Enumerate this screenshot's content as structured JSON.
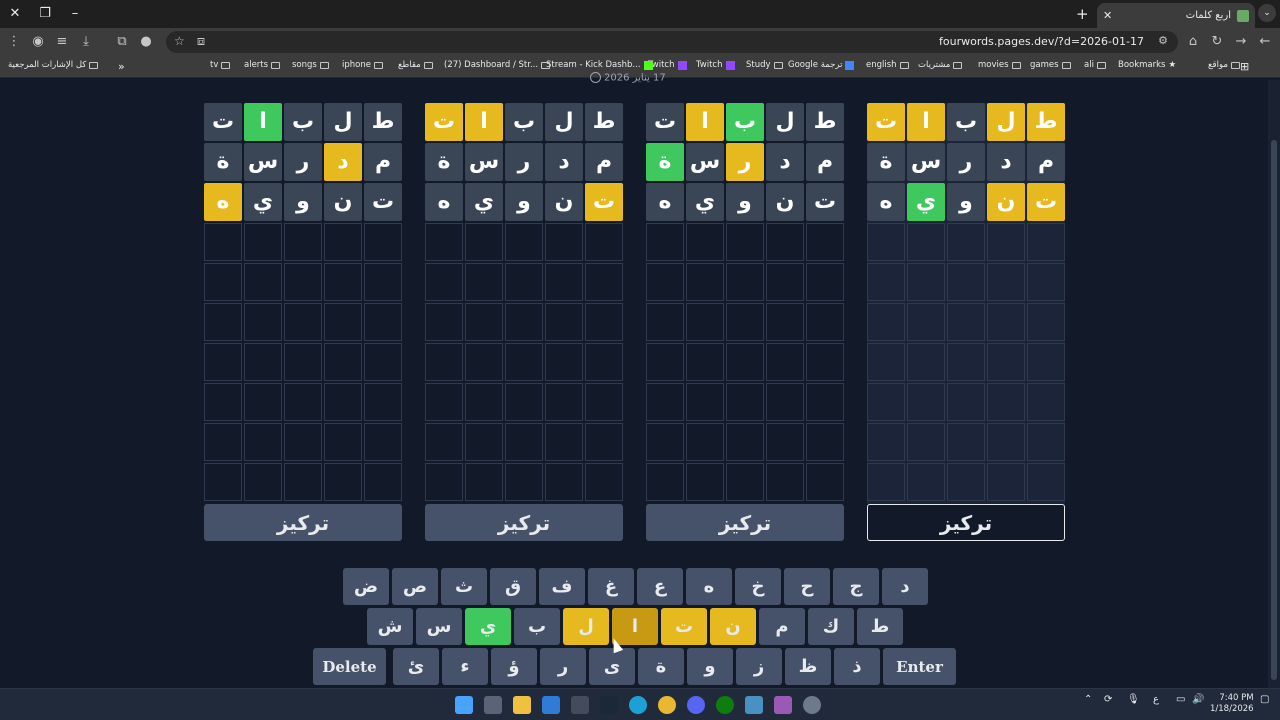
{
  "browser": {
    "tab_title": "أربع كلمات",
    "url": "fourwords.pages.dev/?d=2026-01-17",
    "bookmarks": [
      {
        "label": "مواقع",
        "kind": "folder"
      },
      {
        "label": "Bookmarks",
        "kind": "star"
      },
      {
        "label": "ali",
        "kind": "folder"
      },
      {
        "label": "games",
        "kind": "folder"
      },
      {
        "label": "movies",
        "kind": "folder"
      },
      {
        "label": "مشتريات",
        "kind": "folder"
      },
      {
        "label": "english",
        "kind": "folder"
      },
      {
        "label": "Google ترجمة",
        "kind": "google"
      },
      {
        "label": "Study",
        "kind": "folder"
      },
      {
        "label": "Twitch",
        "kind": "twitch"
      },
      {
        "label": "Twitch",
        "kind": "twitch"
      },
      {
        "label": "Stream - Kick Dashb...",
        "kind": "kick"
      },
      {
        "label": "(27) Dashboard / Str...",
        "kind": "folder"
      },
      {
        "label": "مقاطع",
        "kind": "folder"
      },
      {
        "label": "iphone",
        "kind": "folder"
      },
      {
        "label": "songs",
        "kind": "folder"
      },
      {
        "label": "alerts",
        "kind": "folder"
      },
      {
        "label": "tv",
        "kind": "folder"
      }
    ],
    "all_bookmarks": "كل الإشارات المرجعية",
    "overflow": "»"
  },
  "page": {
    "date": "17 يناير 2026"
  },
  "boards": [
    {
      "focus_label": "تركيز",
      "active": true,
      "rows": [
        [
          {
            "l": "ط",
            "s": "present"
          },
          {
            "l": "ل",
            "s": "present"
          },
          {
            "l": "ب",
            "s": "empty"
          },
          {
            "l": "ا",
            "s": "present"
          },
          {
            "l": "ت",
            "s": "present"
          }
        ],
        [
          {
            "l": "م",
            "s": "empty"
          },
          {
            "l": "د",
            "s": "empty"
          },
          {
            "l": "ر",
            "s": "empty"
          },
          {
            "l": "س",
            "s": "empty"
          },
          {
            "l": "ة",
            "s": "empty"
          }
        ],
        [
          {
            "l": "ت",
            "s": "present"
          },
          {
            "l": "ن",
            "s": "present"
          },
          {
            "l": "و",
            "s": "empty"
          },
          {
            "l": "ي",
            "s": "correct"
          },
          {
            "l": "ه",
            "s": "empty"
          }
        ]
      ]
    },
    {
      "focus_label": "تركيز",
      "active": false,
      "rows": [
        [
          {
            "l": "ط",
            "s": "empty"
          },
          {
            "l": "ل",
            "s": "empty"
          },
          {
            "l": "ب",
            "s": "correct"
          },
          {
            "l": "ا",
            "s": "present"
          },
          {
            "l": "ت",
            "s": "empty"
          }
        ],
        [
          {
            "l": "م",
            "s": "empty"
          },
          {
            "l": "د",
            "s": "empty"
          },
          {
            "l": "ر",
            "s": "present"
          },
          {
            "l": "س",
            "s": "empty"
          },
          {
            "l": "ة",
            "s": "correct"
          }
        ],
        [
          {
            "l": "ت",
            "s": "empty"
          },
          {
            "l": "ن",
            "s": "empty"
          },
          {
            "l": "و",
            "s": "empty"
          },
          {
            "l": "ي",
            "s": "empty"
          },
          {
            "l": "ه",
            "s": "empty"
          }
        ]
      ]
    },
    {
      "focus_label": "تركيز",
      "active": false,
      "rows": [
        [
          {
            "l": "ط",
            "s": "empty"
          },
          {
            "l": "ل",
            "s": "empty"
          },
          {
            "l": "ب",
            "s": "empty"
          },
          {
            "l": "ا",
            "s": "present"
          },
          {
            "l": "ت",
            "s": "present"
          }
        ],
        [
          {
            "l": "م",
            "s": "empty"
          },
          {
            "l": "د",
            "s": "empty"
          },
          {
            "l": "ر",
            "s": "empty"
          },
          {
            "l": "س",
            "s": "empty"
          },
          {
            "l": "ة",
            "s": "empty"
          }
        ],
        [
          {
            "l": "ت",
            "s": "present"
          },
          {
            "l": "ن",
            "s": "empty"
          },
          {
            "l": "و",
            "s": "empty"
          },
          {
            "l": "ي",
            "s": "empty"
          },
          {
            "l": "ه",
            "s": "empty"
          }
        ]
      ]
    },
    {
      "focus_label": "تركيز",
      "active": false,
      "rows": [
        [
          {
            "l": "ط",
            "s": "empty"
          },
          {
            "l": "ل",
            "s": "empty"
          },
          {
            "l": "ب",
            "s": "empty"
          },
          {
            "l": "ا",
            "s": "correct"
          },
          {
            "l": "ت",
            "s": "empty"
          }
        ],
        [
          {
            "l": "م",
            "s": "empty"
          },
          {
            "l": "د",
            "s": "present"
          },
          {
            "l": "ر",
            "s": "empty"
          },
          {
            "l": "س",
            "s": "empty"
          },
          {
            "l": "ة",
            "s": "empty"
          }
        ],
        [
          {
            "l": "ت",
            "s": "empty"
          },
          {
            "l": "ن",
            "s": "empty"
          },
          {
            "l": "و",
            "s": "empty"
          },
          {
            "l": "ي",
            "s": "empty"
          },
          {
            "l": "ه",
            "s": "present"
          }
        ]
      ]
    }
  ],
  "total_rows": 10,
  "keyboard": {
    "rows": [
      [
        {
          "k": "د",
          "s": "empty"
        },
        {
          "k": "ج",
          "s": "empty"
        },
        {
          "k": "ح",
          "s": "empty"
        },
        {
          "k": "خ",
          "s": "empty"
        },
        {
          "k": "ه",
          "s": "empty"
        },
        {
          "k": "ع",
          "s": "empty"
        },
        {
          "k": "غ",
          "s": "empty"
        },
        {
          "k": "ف",
          "s": "empty"
        },
        {
          "k": "ق",
          "s": "empty"
        },
        {
          "k": "ث",
          "s": "empty"
        },
        {
          "k": "ص",
          "s": "empty"
        },
        {
          "k": "ض",
          "s": "empty"
        }
      ],
      [
        {
          "k": "ط",
          "s": "empty"
        },
        {
          "k": "ك",
          "s": "empty"
        },
        {
          "k": "م",
          "s": "empty"
        },
        {
          "k": "ن",
          "s": "present"
        },
        {
          "k": "ت",
          "s": "present"
        },
        {
          "k": "ا",
          "s": "present-dark"
        },
        {
          "k": "ل",
          "s": "present"
        },
        {
          "k": "ب",
          "s": "empty"
        },
        {
          "k": "ي",
          "s": "correct"
        },
        {
          "k": "س",
          "s": "empty"
        },
        {
          "k": "ش",
          "s": "empty"
        }
      ],
      [
        {
          "k": "Enter",
          "s": "wide"
        },
        {
          "k": "ذ",
          "s": "empty"
        },
        {
          "k": "ظ",
          "s": "empty"
        },
        {
          "k": "ز",
          "s": "empty"
        },
        {
          "k": "و",
          "s": "empty"
        },
        {
          "k": "ة",
          "s": "empty"
        },
        {
          "k": "ى",
          "s": "empty"
        },
        {
          "k": "ر",
          "s": "empty"
        },
        {
          "k": "ؤ",
          "s": "empty"
        },
        {
          "k": "ء",
          "s": "empty"
        },
        {
          "k": "ئ",
          "s": "empty"
        },
        {
          "k": "Delete",
          "s": "wide"
        }
      ]
    ]
  },
  "taskbar": {
    "time": "7:40 PM",
    "date": "1/18/2026",
    "lang": "ع"
  },
  "colors": {
    "present": "#e6b91f",
    "correct": "#3ec85e",
    "tile": "#3a4556",
    "background": "#121a2a"
  }
}
